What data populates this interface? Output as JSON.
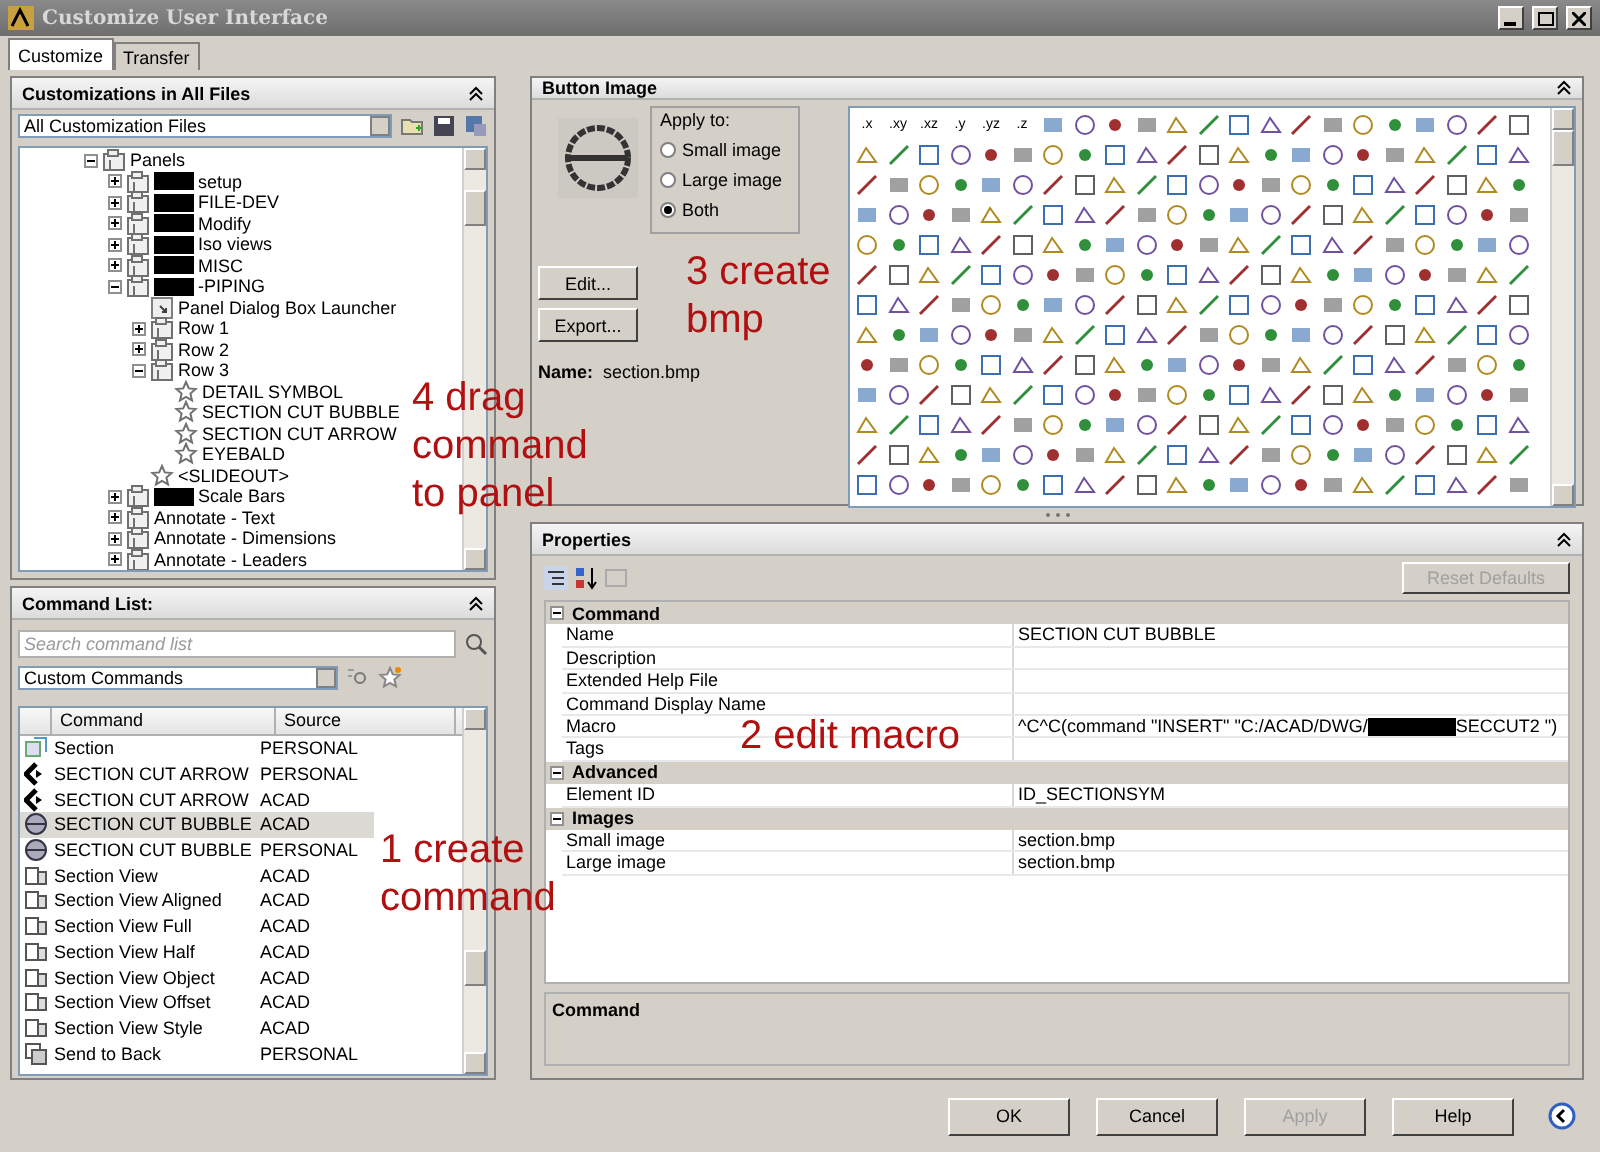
{
  "window": {
    "title": "Customize User Interface"
  },
  "tabs": [
    {
      "label": "Customize",
      "selected": true
    },
    {
      "label": "Transfer",
      "selected": false
    }
  ],
  "customizations": {
    "title": "Customizations in All Files",
    "file_select": "All Customization Files",
    "tree": [
      {
        "label": "Panels",
        "kind": "folder",
        "expanded": true,
        "redacted": false,
        "children": [
          {
            "label": "setup",
            "kind": "folder",
            "expanded": false,
            "redacted": true
          },
          {
            "label": "FILE-DEV",
            "kind": "folder",
            "expanded": false,
            "redacted": true
          },
          {
            "label": "Modify",
            "kind": "folder",
            "expanded": false,
            "redacted": true
          },
          {
            "label": "Iso views",
            "kind": "folder",
            "expanded": false,
            "redacted": true
          },
          {
            "label": "MISC",
            "kind": "folder",
            "expanded": false,
            "redacted": true
          },
          {
            "label": "-PIPING",
            "kind": "folder",
            "expanded": true,
            "redacted": true,
            "children": [
              {
                "label": "Panel Dialog Box Launcher",
                "kind": "launcher"
              },
              {
                "label": "Row 1",
                "kind": "row",
                "expanded": false,
                "redacted": false
              },
              {
                "label": "Row 2",
                "kind": "row",
                "expanded": false,
                "redacted": false
              },
              {
                "label": "Row 3",
                "kind": "row",
                "expanded": true,
                "redacted": false,
                "children": [
                  {
                    "label": "DETAIL SYMBOL",
                    "kind": "command"
                  },
                  {
                    "label": "SECTION CUT BUBBLE",
                    "kind": "command"
                  },
                  {
                    "label": "SECTION CUT ARROW",
                    "kind": "command"
                  },
                  {
                    "label": "EYEBALD",
                    "kind": "command"
                  }
                ]
              },
              {
                "label": "<SLIDEOUT>",
                "kind": "command"
              }
            ]
          },
          {
            "label": "Scale Bars",
            "kind": "folder",
            "expanded": false,
            "redacted": true
          },
          {
            "label": "Annotate - Text",
            "kind": "folder",
            "expanded": false,
            "redacted": false
          },
          {
            "label": "Annotate - Dimensions",
            "kind": "folder",
            "expanded": false,
            "redacted": false
          },
          {
            "label": "Annotate - Leaders",
            "kind": "folder",
            "expanded": false,
            "redacted": false
          }
        ]
      }
    ]
  },
  "command_list": {
    "title": "Command List:",
    "search": {
      "placeholder": "Search command list"
    },
    "filter": "Custom Commands",
    "columns": [
      "Command",
      "Source"
    ],
    "rows": [
      {
        "name": "Section",
        "source": "PERSONAL",
        "kind": "section",
        "selected": false
      },
      {
        "name": "SECTION CUT ARROW",
        "source": "PERSONAL",
        "kind": "arrow",
        "selected": false
      },
      {
        "name": "SECTION CUT ARROW",
        "source": "ACAD",
        "kind": "arrow",
        "selected": false
      },
      {
        "name": "SECTION CUT BUBBLE",
        "source": "ACAD",
        "kind": "bubble",
        "selected": true
      },
      {
        "name": "SECTION CUT BUBBLE",
        "source": "PERSONAL",
        "kind": "bubble",
        "selected": false
      },
      {
        "name": "Section View",
        "source": "ACAD",
        "kind": "view",
        "selected": false
      },
      {
        "name": "Section View Aligned",
        "source": "ACAD",
        "kind": "view",
        "selected": false
      },
      {
        "name": "Section View Full",
        "source": "ACAD",
        "kind": "view",
        "selected": false
      },
      {
        "name": "Section View Half",
        "source": "ACAD",
        "kind": "view",
        "selected": false
      },
      {
        "name": "Section View Object",
        "source": "ACAD",
        "kind": "view",
        "selected": false
      },
      {
        "name": "Section View Offset",
        "source": "ACAD",
        "kind": "view",
        "selected": false
      },
      {
        "name": "Section View Style",
        "source": "ACAD",
        "kind": "view",
        "selected": false
      },
      {
        "name": "Send to Back",
        "source": "PERSONAL",
        "kind": "back",
        "selected": false
      }
    ]
  },
  "button_image": {
    "title": "Button Image",
    "buttons": [
      "Edit...",
      "Export..."
    ],
    "apply_to": {
      "label": "Apply to:",
      "options": [
        {
          "label": "Small image",
          "selected": false
        },
        {
          "label": "Large image",
          "selected": false
        },
        {
          "label": "Both",
          "selected": true
        }
      ]
    },
    "name_label": "Name:",
    "name_value": "section.bmp",
    "palette_labels": [
      ".x",
      ".xy",
      ".xz",
      ".y",
      ".yz",
      ".z"
    ]
  },
  "properties": {
    "title": "Properties",
    "reset_button": {
      "label": "Reset Defaults",
      "disabled": true
    },
    "groups": [
      {
        "label": "Command",
        "expanded": true,
        "rows": [
          {
            "name": "Name",
            "value": "SECTION CUT BUBBLE"
          },
          {
            "name": "Description"
          },
          {
            "name": "Extended Help File"
          },
          {
            "name": "Command Display Name"
          },
          {
            "name": "Macro",
            "value": "^C^C(command \"INSERT\" \"C:/ACAD/DWG/",
            "redacted": true,
            "value_after": "SECCUT2 \")"
          },
          {
            "name": "Tags"
          }
        ]
      },
      {
        "label": "Advanced",
        "expanded": true,
        "rows": [
          {
            "name": "Element ID",
            "value": "ID_SECTIONSYM"
          }
        ]
      },
      {
        "label": "Images",
        "expanded": true,
        "rows": [
          {
            "name": "Small image",
            "value": "section.bmp"
          },
          {
            "name": "Large image",
            "value": "section.bmp"
          }
        ]
      }
    ],
    "help_title": "Command"
  },
  "buttons": [
    {
      "label": "OK",
      "disabled": false
    },
    {
      "label": "Cancel",
      "disabled": false
    },
    {
      "label": "Apply",
      "disabled": true
    },
    {
      "label": "Help",
      "disabled": false
    }
  ],
  "annotations": [
    "4 drag\ncommand\nto panel",
    "3 create\nbmp",
    "2 edit macro",
    "1 create\ncommand"
  ]
}
